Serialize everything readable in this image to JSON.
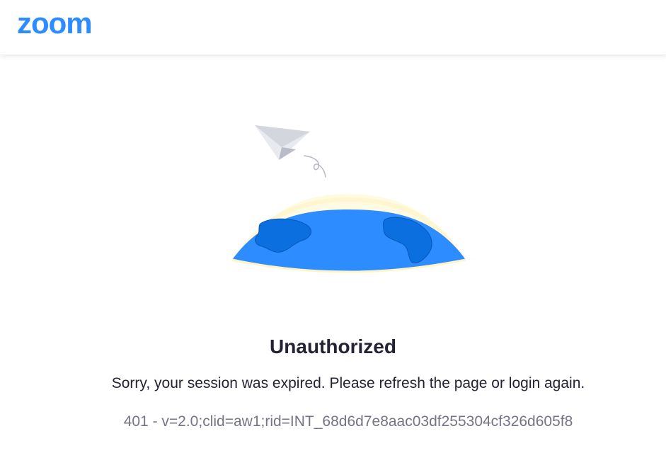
{
  "header": {
    "logo_text": "zoom",
    "brand_color": "#2d8cff"
  },
  "illustration": {
    "name": "paper-plane-over-globe",
    "colors": {
      "globe": "#2d8cff",
      "continents": "#0b6fe0",
      "glow": "#fff8d6",
      "plane": "#e8e9ee"
    }
  },
  "error": {
    "title": "Unauthorized",
    "message": "Sorry, your session was expired. Please refresh the page or login again.",
    "code": "401 - v=2.0;clid=aw1;rid=INT_68d6d7e8aac03df255304cf326d605f8"
  }
}
